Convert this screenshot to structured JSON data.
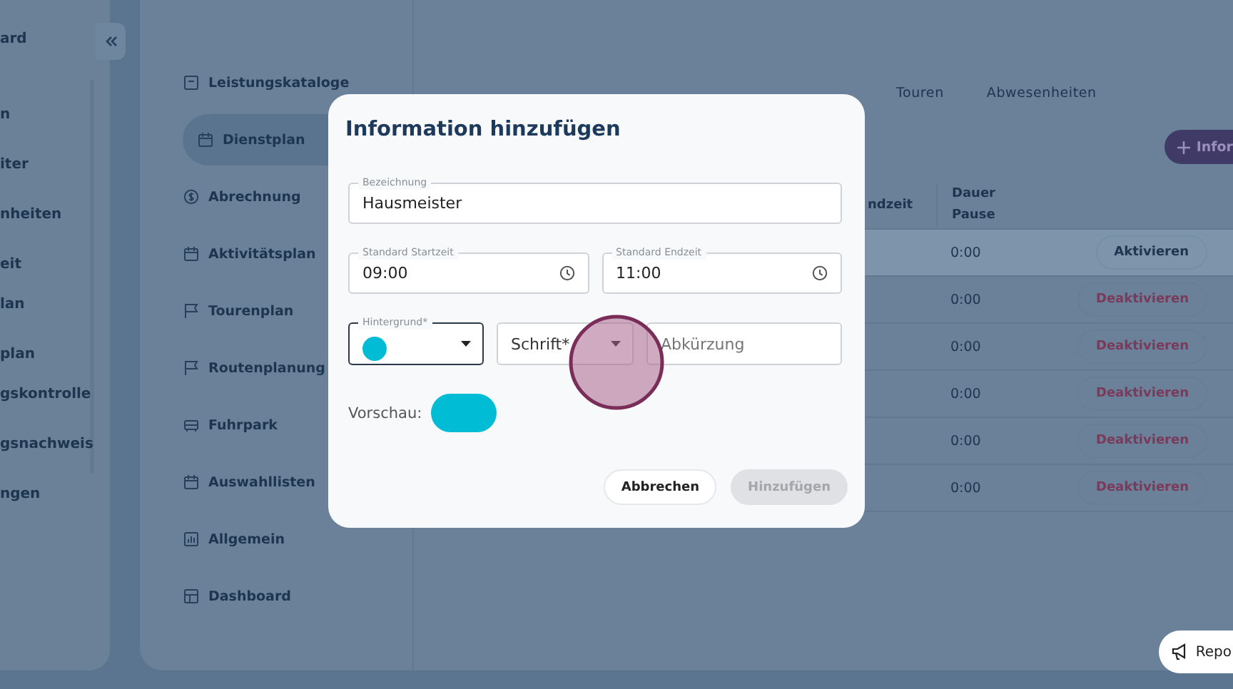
{
  "sidebar": {
    "title": "ard",
    "groups": [
      {
        "items": [
          {
            "label": "n"
          },
          {
            "label": "iter"
          },
          {
            "label": "nheiten"
          },
          {
            "label": "eit"
          }
        ]
      },
      {
        "items": [
          {
            "label": "lan"
          },
          {
            "label": "plan"
          }
        ]
      },
      {
        "items": [
          {
            "label": "gskontrolle"
          },
          {
            "label": "gsnachweis"
          },
          {
            "label": "ngen"
          }
        ]
      }
    ]
  },
  "subnav": {
    "items": [
      {
        "label": "Leistungskataloge",
        "selected": false
      },
      {
        "label": "Dienstplan",
        "selected": true
      },
      {
        "label": "Abrechnung",
        "selected": false
      },
      {
        "label": "Aktivitätsplan",
        "selected": false
      },
      {
        "label": "Tourenplan",
        "selected": false
      },
      {
        "label": "Routenplanung",
        "selected": false
      },
      {
        "label": "Fuhrpark",
        "selected": false
      },
      {
        "label": "Auswahllisten",
        "selected": false
      },
      {
        "label": "Allgemein",
        "selected": false
      },
      {
        "label": "Dashboard",
        "selected": false
      }
    ]
  },
  "tabs": [
    {
      "label": "Touren",
      "selected": false
    },
    {
      "label": "Abwesenheiten",
      "selected": false
    }
  ],
  "add_button": {
    "label": "Infor"
  },
  "table": {
    "columns": [
      "ndzeit",
      "Dauer Pause"
    ],
    "rows": [
      {
        "duration": "0:00",
        "action": "Aktivieren",
        "kind": "activate",
        "highlighted": true
      },
      {
        "duration": "0:00",
        "action": "Deaktivieren",
        "kind": "deactivate",
        "highlighted": false
      },
      {
        "duration": "0:00",
        "action": "Deaktivieren",
        "kind": "deactivate",
        "highlighted": false
      },
      {
        "duration": "0:00",
        "action": "Deaktivieren",
        "kind": "deactivate",
        "highlighted": false
      },
      {
        "duration": "0:00",
        "action": "Deaktivieren",
        "kind": "deactivate",
        "highlighted": false
      },
      {
        "duration": "0:00",
        "action": "Deaktivieren",
        "kind": "deactivate",
        "highlighted": false
      }
    ]
  },
  "dialog": {
    "title": "Information hinzufügen",
    "name_field": {
      "label": "Bezeichnung",
      "value": "Hausmeister"
    },
    "start_field": {
      "label": "Standard Startzeit",
      "value": "09:00"
    },
    "end_field": {
      "label": "Standard Endzeit",
      "value": "11:00"
    },
    "background_select": {
      "label": "Hintergrund*",
      "color": "#00bcd4",
      "focused": true
    },
    "font_select": {
      "label": "Schrift*"
    },
    "abbreviation_field": {
      "placeholder": "Abkürzung"
    },
    "preview": {
      "label": "Vorschau:",
      "color": "#00bcd4"
    },
    "buttons": [
      {
        "label": "Abbrechen",
        "disabled": false
      },
      {
        "label": "Hinzufügen",
        "disabled": true
      }
    ]
  },
  "click_marker": {
    "visible": true
  },
  "report_button": {
    "label": "Repo"
  }
}
